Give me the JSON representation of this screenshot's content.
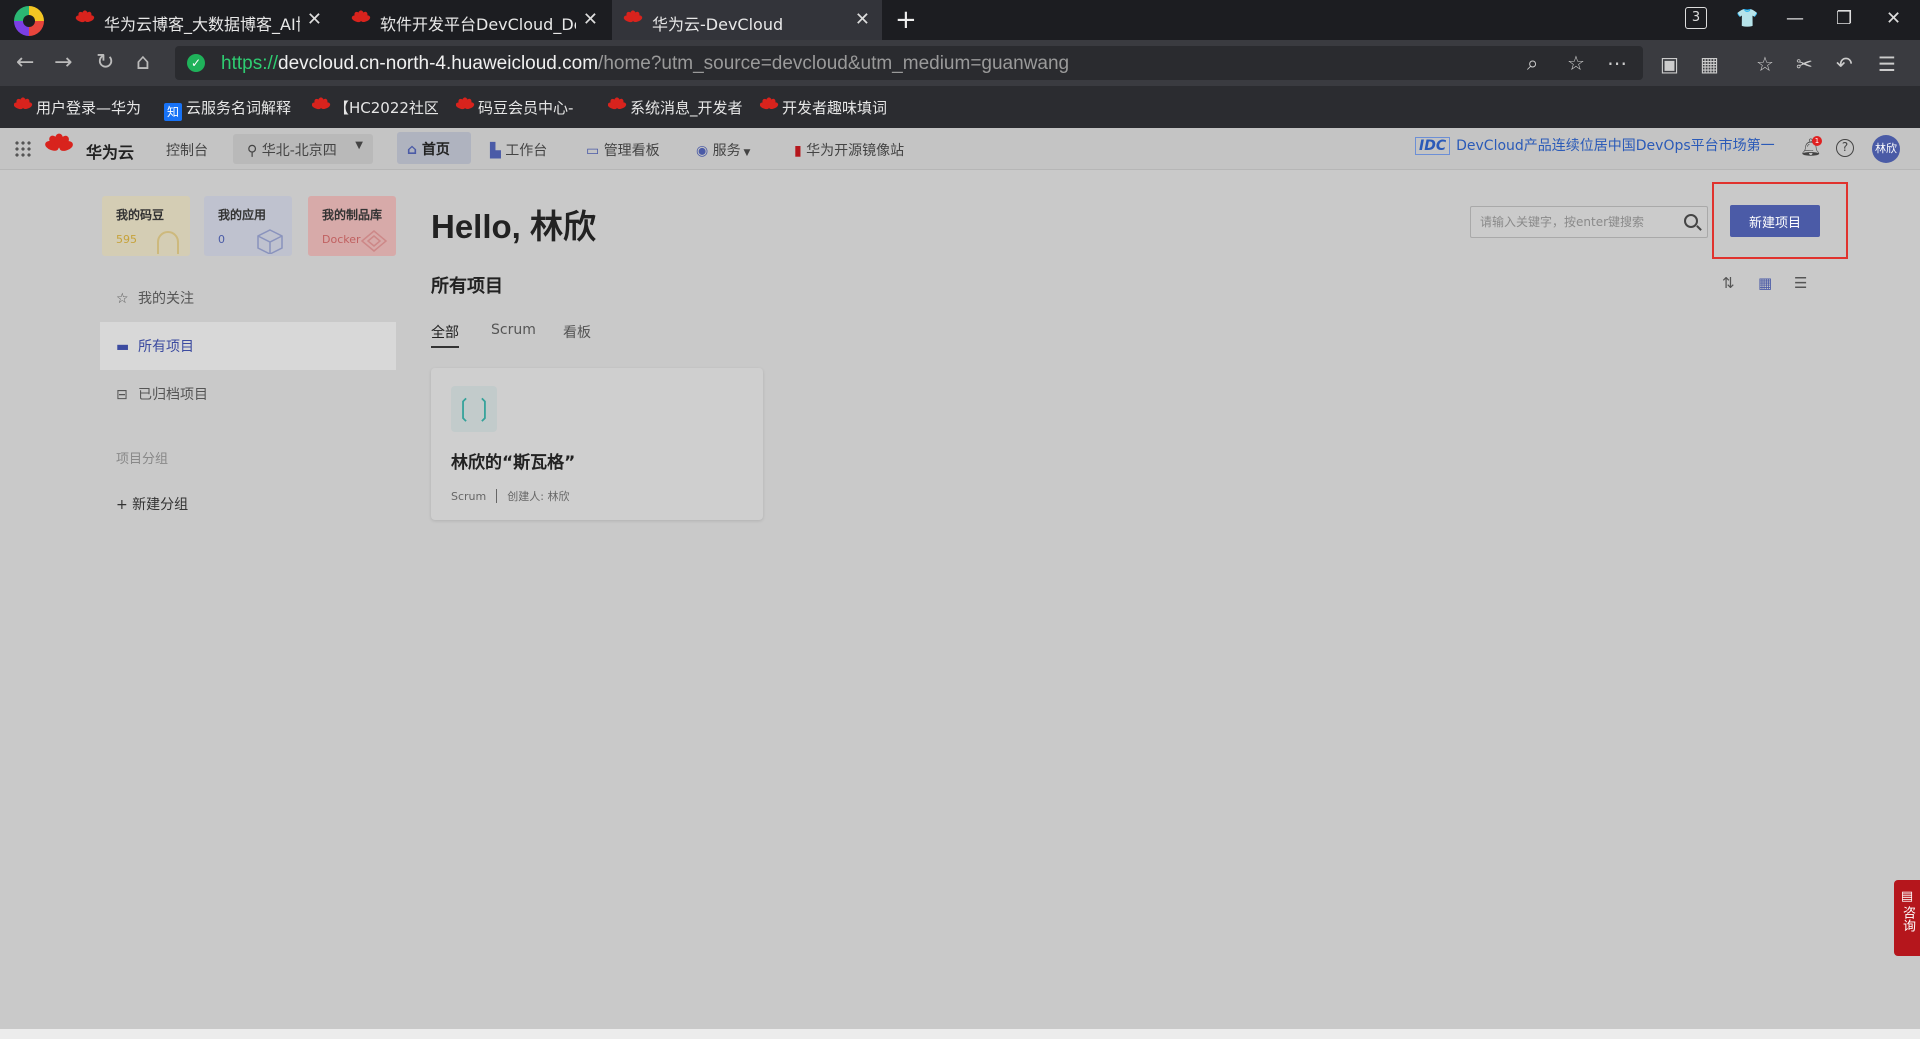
{
  "browser": {
    "tabs": [
      {
        "title": "华为云博客_大数据博客_AI博客"
      },
      {
        "title": "软件开发平台DevCloud_DevOps"
      },
      {
        "title": "华为云-DevCloud"
      }
    ],
    "tab_count": "3",
    "url": {
      "protocol": "https://",
      "host": "devcloud.cn-north-4.huaweicloud.com",
      "path": "/home?utm_source=devcloud&utm_medium=guanwang"
    },
    "bookmarks": [
      {
        "label": "用户登录—华为",
        "icon": "huawei-icon"
      },
      {
        "label": "云服务名词解释",
        "icon": "zhihu-icon"
      },
      {
        "label": "【HC2022社区",
        "icon": "huawei-icon"
      },
      {
        "label": "码豆会员中心-",
        "icon": "huawei-icon"
      },
      {
        "label": "系统消息_开发者",
        "icon": "huawei-icon"
      },
      {
        "label": "开发者趣味填词",
        "icon": "huawei-icon"
      }
    ],
    "zhihu_glyph": "知"
  },
  "header": {
    "brand": "华为云",
    "console": "控制台",
    "region": "华北-北京四",
    "nav": [
      {
        "label": "首页"
      },
      {
        "label": "工作台"
      },
      {
        "label": "管理看板"
      },
      {
        "label": "服务"
      },
      {
        "label": "华为开源镜像站"
      }
    ],
    "promo_badge": "IDC",
    "promo_text": "DevCloud产品连续位居中国DevOps平台市场第一",
    "notification_count": "1",
    "avatar_text": "林欣"
  },
  "sidebar": {
    "stats": [
      {
        "label": "我的码豆",
        "value": "595"
      },
      {
        "label": "我的应用",
        "value": "0"
      },
      {
        "label": "我的制品库",
        "value": "Docker"
      }
    ],
    "items": [
      {
        "label": "我的关注"
      },
      {
        "label": "所有项目"
      },
      {
        "label": "已归档项目"
      }
    ],
    "group_title": "项目分组",
    "new_group": "+ 新建分组"
  },
  "main": {
    "greeting": "Hello, 林欣",
    "search_placeholder": "请输入关键字，按enter键搜索",
    "new_project": "新建项目",
    "section_title": "所有项目",
    "tabs": [
      {
        "label": "全部"
      },
      {
        "label": "Scrum"
      },
      {
        "label": "看板"
      }
    ],
    "projects": [
      {
        "icon_glyph": "❲❳",
        "name": "林欣的“斯瓦格”",
        "type": "Scrum",
        "creator": "创建人: 林欣"
      }
    ]
  },
  "consult": "咨询",
  "colors": {
    "accent": "#4b5ba7",
    "highlight": "#e0322d",
    "huawei_red": "#d8231d"
  }
}
